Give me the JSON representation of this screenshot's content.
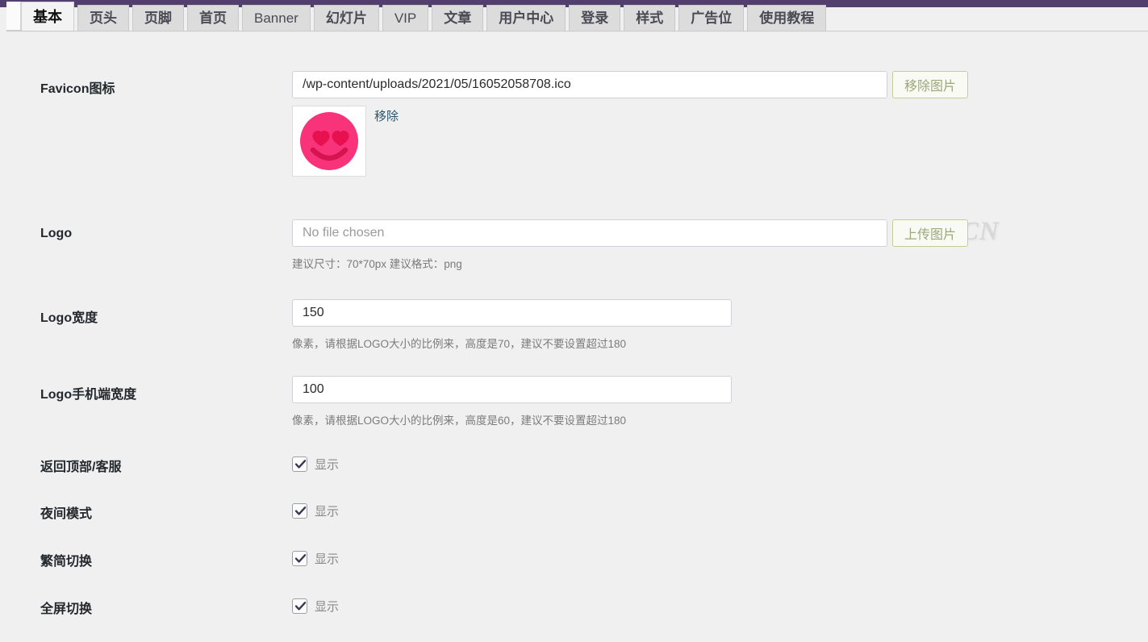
{
  "theme": {
    "adminbar_color": "#523f6d",
    "page_background": "#f0f0f0",
    "tab_active_background": "#f3f3f3",
    "tab_inactive_background": "#dcdcdc",
    "button_border_color": "#c3cf9a",
    "button_text_color": "#9aa87c",
    "link_color": "#27546e",
    "checkbox_check_color": "#3d3652"
  },
  "tabs": [
    {
      "label": "基本",
      "active": true,
      "latin": false
    },
    {
      "label": "页头",
      "active": false,
      "latin": false
    },
    {
      "label": "页脚",
      "active": false,
      "latin": false
    },
    {
      "label": "首页",
      "active": false,
      "latin": false
    },
    {
      "label": "Banner",
      "active": false,
      "latin": true
    },
    {
      "label": "幻灯片",
      "active": false,
      "latin": false
    },
    {
      "label": "VIP",
      "active": false,
      "latin": true
    },
    {
      "label": "文章",
      "active": false,
      "latin": false
    },
    {
      "label": "用户中心",
      "active": false,
      "latin": false
    },
    {
      "label": "登录",
      "active": false,
      "latin": false
    },
    {
      "label": "样式",
      "active": false,
      "latin": false
    },
    {
      "label": "广告位",
      "active": false,
      "latin": false
    },
    {
      "label": "使用教程",
      "active": false,
      "latin": false
    }
  ],
  "watermark": "3KA.CN",
  "fields": {
    "favicon": {
      "label": "Favicon图标",
      "value": "/wp-content/uploads/2021/05/16052058708.ico",
      "placeholder": "",
      "button": "移除图片",
      "remove_link": "移除",
      "preview_icon": "pink-heart-eyes-smiley"
    },
    "logo": {
      "label": "Logo",
      "value": "",
      "placeholder": "No file chosen",
      "button": "上传图片",
      "hint": "建议尺寸：70*70px 建议格式：png"
    },
    "logo_width": {
      "label": "Logo宽度",
      "value": "150",
      "hint": "像素，请根据LOGO大小的比例来，高度是70，建议不要设置超过180"
    },
    "logo_mobile_width": {
      "label": "Logo手机端宽度",
      "value": "100",
      "hint": "像素，请根据LOGO大小的比例来，高度是60，建议不要设置超过180"
    }
  },
  "toggles": [
    {
      "label": "返回顶部/客服",
      "checkbox_label": "显示",
      "checked": true
    },
    {
      "label": "夜间模式",
      "checkbox_label": "显示",
      "checked": true
    },
    {
      "label": "繁简切换",
      "checkbox_label": "显示",
      "checked": true
    },
    {
      "label": "全屏切换",
      "checkbox_label": "显示",
      "checked": true
    }
  ]
}
